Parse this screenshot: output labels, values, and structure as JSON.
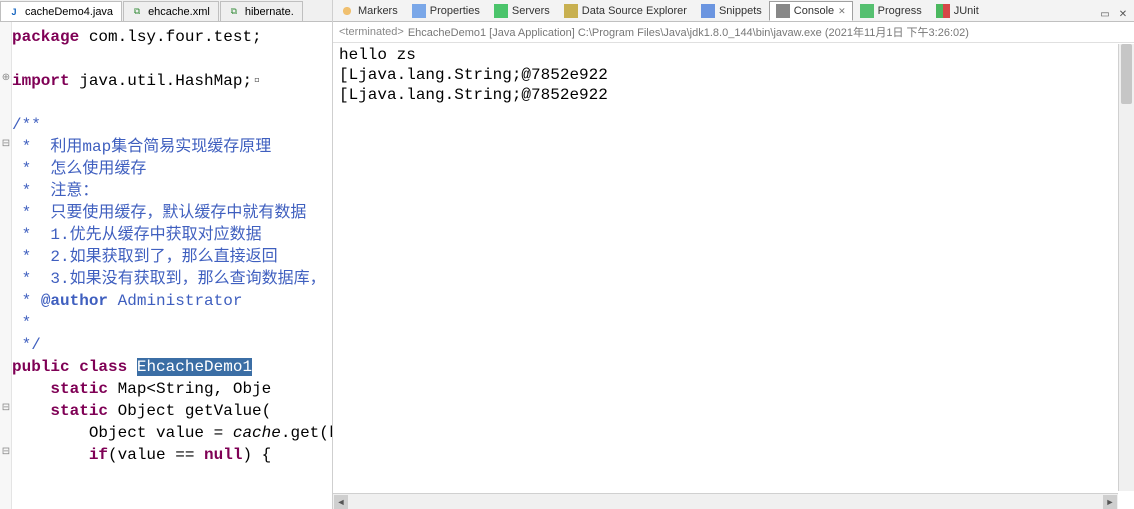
{
  "editor": {
    "tabs": [
      {
        "label": "cacheDemo4.java",
        "kind": "java",
        "active": true
      },
      {
        "label": "ehcache.xml",
        "kind": "xml",
        "active": false
      },
      {
        "label": "hibernate.",
        "kind": "xml",
        "active": false
      }
    ],
    "code": {
      "l1_kw_package": "package",
      "l1_pkg": " com.lsy.four.test;",
      "l3_kw_import": "import",
      "l3_rest": " java.util.HashMap;",
      "jd_open": "/**",
      "jd1": " *  利用map集合简易实现缓存原理",
      "jd2": " *  怎么使用缓存",
      "jd3": " *  注意：",
      "jd4": " *  只要使用缓存，默认缓存中就有数据",
      "jd5": " *  1.优先从缓存中获取对应数据",
      "jd6": " *  2.如果获取到了，那么直接返回",
      "jd7": " *  3.如果没有获取到，那么查询数据库，",
      "jd_auth_pre": " * ",
      "jd_auth_tag": "@author",
      "jd_auth_name": " Administrator",
      "jd8": " *",
      "jd_close": " */",
      "cl_kw_public": "public",
      "cl_kw_class": "class",
      "cl_name": "EhcacheDemo1",
      "f1_kw_static": "static",
      "f1_rest": " Map<String, Obje",
      "m1_kw_static": "static",
      "m1_rest": " Object getValue(",
      "b1_pre": "        Object value = ",
      "b1_it": "cache",
      "b1_post": ".get(key);",
      "b2_pre": "        ",
      "b2_kw_if": "if",
      "b2_mid": "(value == ",
      "b2_kw_null": "null",
      "b2_post": ") {"
    },
    "gutter_import_expander": "⊕",
    "gutter_fold_minus": "⊟"
  },
  "views": {
    "tabs": [
      {
        "label": "Markers",
        "icon": "markers-icon",
        "color": "#d28a2c"
      },
      {
        "label": "Properties",
        "icon": "properties-icon",
        "color": "#2b6bd6"
      },
      {
        "label": "Servers",
        "icon": "servers-icon",
        "color": "#1ea24a"
      },
      {
        "label": "Data Source Explorer",
        "icon": "data-source-icon",
        "color": "#a58b2c"
      },
      {
        "label": "Snippets",
        "icon": "snippets-icon",
        "color": "#2b6bd6"
      },
      {
        "label": "Console",
        "icon": "console-icon",
        "color": "#555555",
        "active": true,
        "close": "✕"
      },
      {
        "label": "Progress",
        "icon": "progress-icon",
        "color": "#35a048"
      },
      {
        "label": "JUnit",
        "icon": "junit-icon",
        "color": "#2e9a3a"
      }
    ],
    "controls": {
      "min": "▭",
      "max": "✕"
    }
  },
  "console": {
    "terminated_prefix": "<terminated>",
    "launch": " EhcacheDemo1 [Java Application] C:\\Program Files\\Java\\jdk1.8.0_144\\bin\\javaw.exe (2021年11月1日 下午3:26:02)",
    "out1": "hello zs",
    "out2": "[Ljava.lang.String;@7852e922",
    "out3": "[Ljava.lang.String;@7852e922"
  }
}
